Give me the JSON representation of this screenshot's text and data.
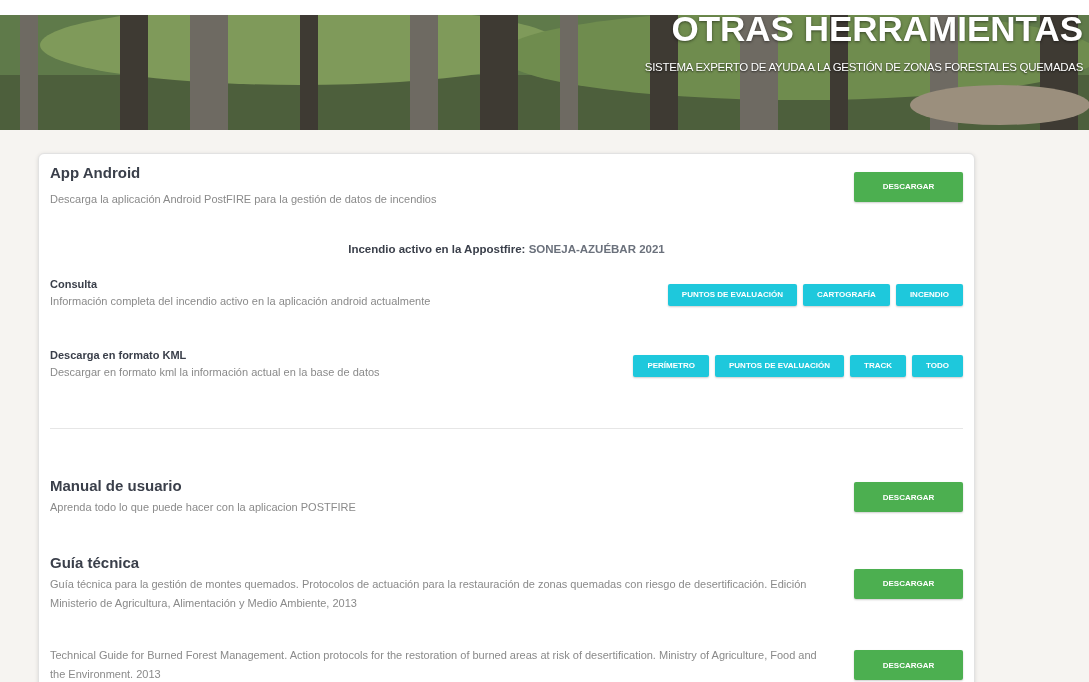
{
  "banner": {
    "title": "OTRAS HERRAMIENTAS",
    "subtitle": "SISTEMA EXPERTO DE AYUDA A LA GESTIÓN DE ZONAS FORESTALES QUEMADAS"
  },
  "app": {
    "title": "App Android",
    "description": "Descarga la aplicación Android PostFIRE para la gestión de datos de incendios",
    "button": "DESCARGAR",
    "active_fire": {
      "label": "Incendio activo en la Appostfire:",
      "value": "SONEJA-AZUÉBAR 2021"
    },
    "rows": [
      {
        "title": "Consulta",
        "description": "Información completa del incendio activo en la aplicación android actualmente",
        "buttons": [
          "PUNTOS DE EVALUACIÓN",
          "CARTOGRAFÍA",
          "INCENDIO"
        ]
      },
      {
        "title": "Descarga en formato KML",
        "description": "Descargar en formato kml la información actual en la base de datos",
        "buttons": [
          "PERÍMETRO",
          "PUNTOS DE EVALUACIÓN",
          "TRACK",
          "TODO"
        ]
      }
    ]
  },
  "documents": [
    {
      "title": "Manual de usuario",
      "description": "Aprenda todo lo que puede hacer con la aplicacion POSTFIRE",
      "button": "DESCARGAR"
    },
    {
      "title": "Guía técnica",
      "description": "Guía técnica para la gestión de montes quemados. Protocolos de actuación para la restauración de zonas quemadas con riesgo de desertificación. Edición Ministerio de Agricultura, Alimentación y Medio Ambiente, 2013",
      "button": "DESCARGAR"
    },
    {
      "description": "Technical Guide for Burned Forest Management. Action protocols for the restoration of burned areas at risk of desertification. Ministry of Agriculture, Food and the Environment. 2013",
      "button": "DESCARGAR"
    }
  ]
}
